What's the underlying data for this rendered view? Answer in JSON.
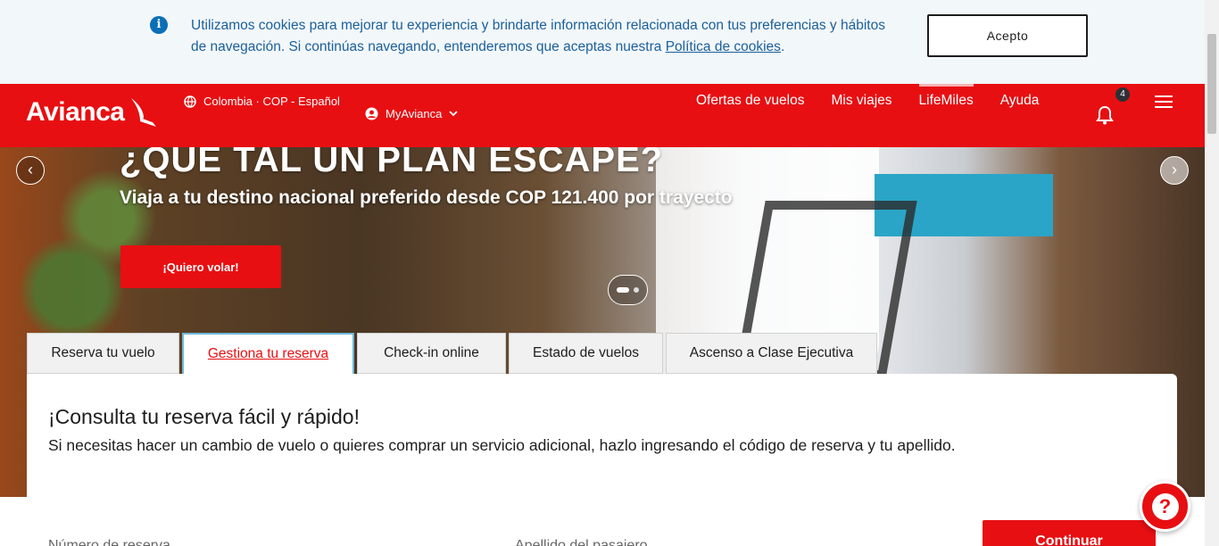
{
  "cookie_banner": {
    "text_before": "Utilizamos cookies para mejorar tu experiencia y brindarte información relacionada con tus preferencias y hábitos de navegación. Si continúas navegando, entenderemos que aceptas nuestra ",
    "policy_link": "Política de cookies",
    "text_after": ".",
    "accept_label": "Acepto",
    "info_icon": "i"
  },
  "header": {
    "logo_text": "Avianca",
    "region_label": "Colombia · COP - Español",
    "account_label": "MyAvianca",
    "nav": [
      {
        "label": "Ofertas de vuelos"
      },
      {
        "label": "Mis viajes"
      },
      {
        "label": "LifeMiles"
      },
      {
        "label": "Ayuda"
      }
    ],
    "notification_count": "4"
  },
  "hero": {
    "title": "¿QUÉ TAL UN PLAN ESCAPE?",
    "subtitle": "Viaja a tu destino nacional preferido desde COP 121.400 por trayecto",
    "cta_label": "¡Quiero volar!",
    "prev_icon": "‹",
    "next_icon": "›"
  },
  "tabs": [
    {
      "label": "Reserva tu vuelo"
    },
    {
      "label": "Gestiona tu reserva"
    },
    {
      "label": "Check-in online"
    },
    {
      "label": "Estado de vuelos"
    },
    {
      "label": "Ascenso a Clase Ejecutiva"
    }
  ],
  "booking": {
    "heading": "¡Consulta tu reserva fácil y rápido!",
    "description": "Si necesitas hacer un cambio de vuelo o quieres comprar un servicio adicional, hazlo ingresando el código de reserva y tu apellido.",
    "field1_label": "Número de reserva",
    "field2_label": "Apellido del pasajero",
    "continue_label": "Continuar"
  },
  "help": {
    "icon_text": "?"
  },
  "colors": {
    "brand_red": "#e70f12",
    "banner_bg": "#f2f7fa",
    "link_blue": "#1b5f9a"
  }
}
